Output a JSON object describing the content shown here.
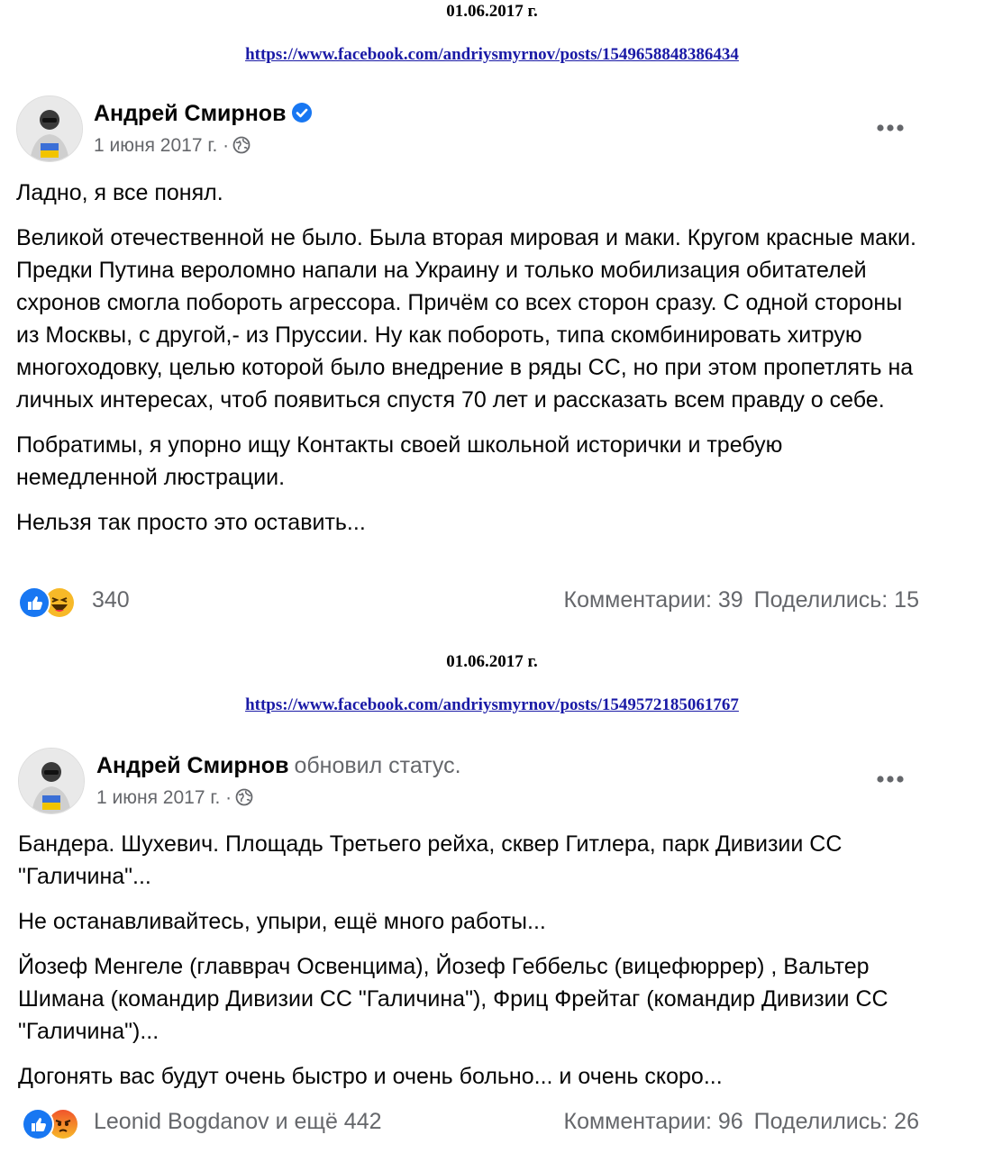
{
  "posts": [
    {
      "date": "01.06.2017 г.",
      "url": "https://www.facebook.com/andriysmyrnov/posts/1549658848386434",
      "author": "Андрей Смирнов",
      "status_text": "",
      "timestamp": "1 июня 2017 г.",
      "separator": "·",
      "privacy_icon": "globe-icon",
      "verified_icon": "verified-badge-icon",
      "paragraphs": [
        "Ладно, я все понял.",
        "Великой отечественной не было. Была вторая мировая и маки. Кругом красные маки. Предки Путина вероломно напали на Украину и только мобилизация обитателей схронов смогла побороть агрессора. Причём со всех сторон сразу. С одной стороны из Москвы, с другой,- из Пруссии. Ну как побороть, типа скомбинировать хитрую многоходовку, целью которой было внедрение в ряды СС, но при этом пропетлять на личных интересах, чтоб появиться спустя 70 лет и рассказать всем правду о себе.",
        "Побратимы, я упорно ищу Контакты своей школьной исторички и требую немедленной люстрации.",
        "Нельзя так просто это оставить..."
      ],
      "reactions": [
        "like-icon",
        "haha-icon"
      ],
      "reactions_text": "340",
      "comments": "Комментарии: 39",
      "shares": "Поделились: 15"
    },
    {
      "date": "01.06.2017 г.",
      "url": "https://www.facebook.com/andriysmyrnov/posts/1549572185061767",
      "author": "Андрей Смирнов",
      "status_text": "обновил статус.",
      "timestamp": "1 июня 2017 г.",
      "separator": "·",
      "privacy_icon": "globe-icon",
      "paragraphs": [
        "Бандера. Шухевич. Площадь Третьего рейха, сквер Гитлера, парк Дивизии СС \"Галичина\"...",
        "Не останавливайтесь, упыри, ещё много работы...",
        "Йозеф Менгеле (главврач Освенцима), Йозеф Геббельс (вицефюррер) , Вальтер Шимана (командир Дивизии СС \"Галичина\"), Фриц Фрейтаг (командир Дивизии СС \"Галичина\")...",
        "Догонять вас будут очень быстро и очень больно... и очень скоро..."
      ],
      "reactions": [
        "like-icon",
        "angry-icon"
      ],
      "reactions_text": "Leonid Bogdanov и ещё 442",
      "comments": "Комментарии: 96",
      "shares": "Поделились: 26"
    }
  ],
  "colors": {
    "link": "#1a1aa6",
    "secondary_text": "#65676b",
    "verified": "#1877f2",
    "like": "#1877f2",
    "haha": "#f7b928",
    "angry": "#e9710f"
  }
}
